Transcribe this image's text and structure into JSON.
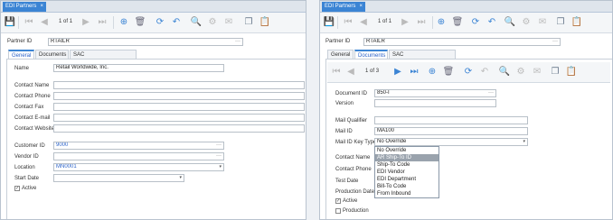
{
  "left": {
    "tab_title": "EDI Partners",
    "close_glyph": "×",
    "pager": {
      "current": "1",
      "of_label": "of",
      "total": "1"
    },
    "partner_id_label": "Partner ID",
    "partner_id_value": "RTAILR",
    "tabs": [
      {
        "label": "General"
      },
      {
        "label": "Documents"
      },
      {
        "label": "SAC Codes/Adjustments"
      }
    ],
    "fields": {
      "name": {
        "label": "Name",
        "value": "Retail Worldwide, Inc."
      },
      "contact_name": {
        "label": "Contact Name",
        "value": ""
      },
      "contact_phone": {
        "label": "Contact Phone",
        "value": ""
      },
      "contact_fax": {
        "label": "Contact Fax",
        "value": ""
      },
      "contact_email": {
        "label": "Contact E-mail",
        "value": ""
      },
      "contact_website": {
        "label": "Contact Website",
        "value": ""
      },
      "customer_id": {
        "label": "Customer ID",
        "value": "9000"
      },
      "vendor_id": {
        "label": "Vendor ID",
        "value": ""
      },
      "location": {
        "label": "Location",
        "value": "MN0001"
      },
      "start_date": {
        "label": "Start Date",
        "value": ""
      }
    },
    "active_label": "Active",
    "active_checked": "✓"
  },
  "right": {
    "tab_title": "EDI Partners",
    "close_glyph": "×",
    "pager": {
      "current": "1",
      "of_label": "of",
      "total": "1"
    },
    "partner_id_label": "Partner ID",
    "partner_id_value": "RTAILR",
    "tabs": [
      {
        "label": "General"
      },
      {
        "label": "Documents"
      },
      {
        "label": "SAC Codes/Adjustments"
      }
    ],
    "inner_pager": {
      "current": "1",
      "of_label": "of",
      "total": "3"
    },
    "fields": {
      "document_id": {
        "label": "Document ID",
        "value": "850-I"
      },
      "version": {
        "label": "Version",
        "value": ""
      },
      "mail_qualifier": {
        "label": "Mail Qualifier",
        "value": ""
      },
      "mail_id": {
        "label": "Mail ID",
        "value": "MA100"
      },
      "mail_id_key_type": {
        "label": "Mail ID Key Type",
        "value": "No Override"
      },
      "contact_name": {
        "label": "Contact Name"
      },
      "contact_phone": {
        "label": "Contact Phone"
      },
      "test_date": {
        "label": "Test Date"
      },
      "production_date": {
        "label": "Production Date"
      }
    },
    "dropdown_options": [
      "No Override",
      "AR Ship-To ID",
      "Ship-To Code",
      "EDI Vendor",
      "EDI Department",
      "Bill-To Code",
      "From Inbound"
    ],
    "active_label": "Active",
    "active_checked": "✓",
    "production_label": "Production"
  },
  "icons": {
    "save": "💾",
    "first": "⏮",
    "prev": "◀",
    "next": "▶",
    "last": "⏭",
    "add": "⊕",
    "delete": "🗑",
    "refresh": "⟳",
    "undo": "↶",
    "search": "🔍",
    "settings": "⚙",
    "mail": "✉",
    "copy": "❐",
    "paste": "📋",
    "ellipsis": "···",
    "caret": "▾"
  },
  "colors": {
    "accent": "#3b84d4",
    "link": "#2a62c9",
    "highlight": "#9aa3ad"
  }
}
